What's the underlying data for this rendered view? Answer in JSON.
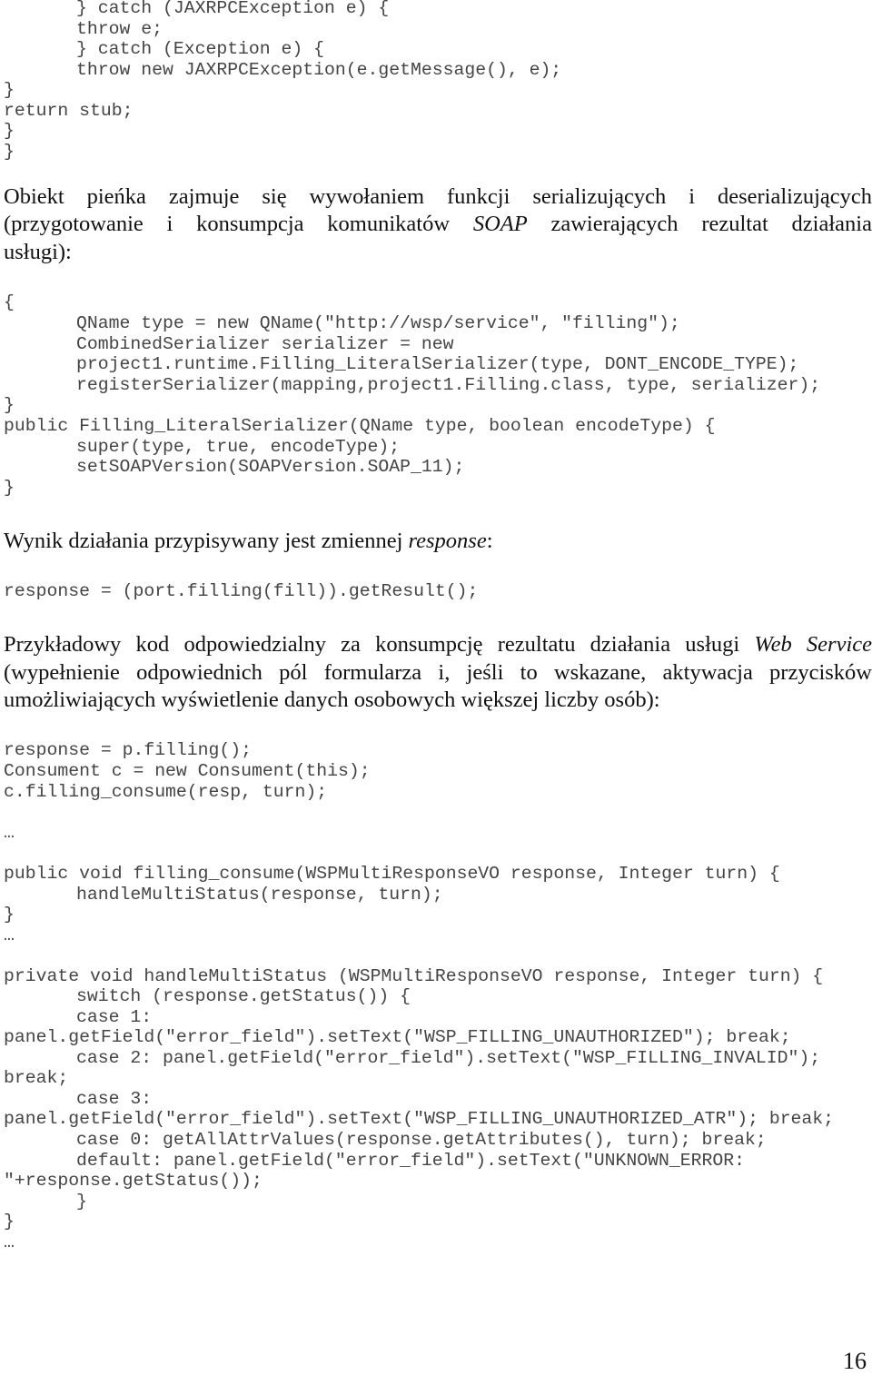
{
  "code_block_1": [
    "} catch (JAXRPCException e) {",
    "throw e;",
    "} catch (Exception e) {",
    "throw new JAXRPCException(e.getMessage(), e);",
    "}",
    "return stub;",
    "}",
    "}"
  ],
  "paragraph_1": {
    "line1": "Obiekt pieńka zajmuje się wywołaniem funkcji serializujących i deserializujących",
    "line2_pre": "(przygotowanie i konsumpcja komunikatów ",
    "line2_em": "SOAP",
    "line2_post": " zawierających rezultat działania",
    "line3": "usługi):"
  },
  "code_block_2": [
    "{",
    "QName type = new QName(\"http://wsp/service\", \"filling\");",
    "CombinedSerializer serializer = new",
    "project1.runtime.Filling_LiteralSerializer(type, DONT_ENCODE_TYPE);",
    "registerSerializer(mapping,project1.Filling.class, type, serializer);",
    "}",
    "public Filling_LiteralSerializer(QName type, boolean encodeType) {",
    "super(type, true, encodeType);",
    "setSOAPVersion(SOAPVersion.SOAP_11);",
    "}"
  ],
  "paragraph_2": {
    "pre": "Wynik działania przypisywany jest zmiennej ",
    "em": "response",
    "post": ":"
  },
  "code_block_3": [
    "response = (port.filling(fill)).getResult();"
  ],
  "paragraph_3": {
    "line1_pre": "Przykładowy kod odpowiedzialny za konsumpcję rezultatu działania usługi ",
    "line1_em": "Web Service",
    "line2": "(wypełnienie odpowiednich pól formularza i, jeśli to wskazane, aktywacja przycisków",
    "line3": "umożliwiających wyświetlenie danych osobowych większej liczby osób):"
  },
  "code_block_4": [
    "response = p.filling();",
    "Consument c = new Consument(this);",
    "c.filling_consume(resp, turn);",
    "…",
    "public void filling_consume(WSPMultiResponseVO response, Integer turn) {",
    "handleMultiStatus(response, turn);",
    "}",
    "…",
    "private void handleMultiStatus (WSPMultiResponseVO response, Integer turn) {",
    "switch (response.getStatus()) {",
    "case 1:",
    "panel.getField(\"error_field\").setText(\"WSP_FILLING_UNAUTHORIZED\"); break;",
    "case 2: panel.getField(\"error_field\").setText(\"WSP_FILLING_INVALID\");",
    "break;",
    "case 3:",
    "panel.getField(\"error_field\").setText(\"WSP_FILLING_UNAUTHORIZED_ATR\"); break;",
    "case 0: getAllAttrValues(response.getAttributes(), turn); break;",
    "default: panel.getField(\"error_field\").setText(\"UNKNOWN_ERROR:",
    "\"+response.getStatus());",
    "}",
    "}",
    "…"
  ],
  "page_number": "16"
}
